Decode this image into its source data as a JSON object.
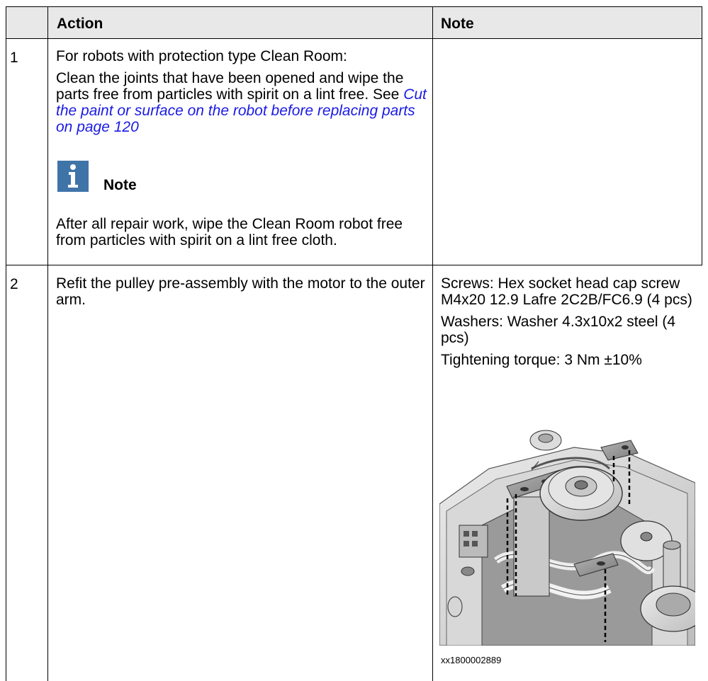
{
  "table": {
    "headers": {
      "num": "",
      "action": "Action",
      "note": "Note"
    },
    "rows": [
      {
        "num": "1",
        "action_lead": "For robots with protection type Clean Room:",
        "action_body": "Clean the joints that have been opened and wipe the parts free from particles with spirit on a lint free. See ",
        "action_link": "Cut the paint or surface on the robot before replacing parts on page 120",
        "note_box_title": "Note",
        "note_box_body": "After all repair work, wipe the Clean Room robot free from particles with spirit on a lint free cloth.",
        "note": ""
      },
      {
        "num": "2",
        "action": "Refit the pulley pre-assembly with the motor to the outer arm.",
        "note_screws": "Screws: Hex socket head cap screw M4x20 12.9 Lafre 2C2B/FC6.9 (4 pcs)",
        "note_washers": "Washers: Washer 4.3x10x2 steel (4 pcs)",
        "note_torque": "Tightening torque: 3 Nm ±10%",
        "figure_caption": "xx1800002889"
      }
    ]
  },
  "icons": {
    "note": "info-i-icon"
  },
  "colors": {
    "header_bg": "#e8e8e8",
    "link": "#1a1ae6",
    "note_icon_bg": "#3f74a8"
  }
}
